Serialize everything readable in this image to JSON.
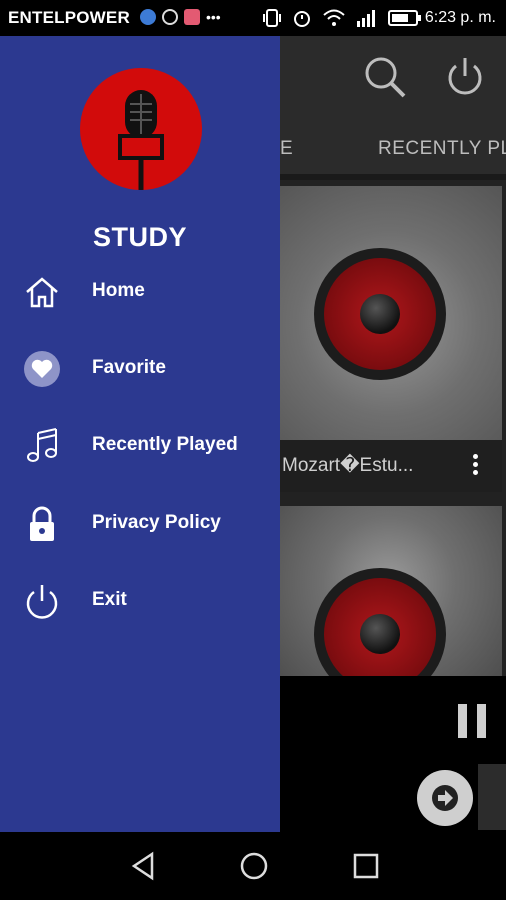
{
  "status_bar": {
    "carrier": "ENTELPOWER",
    "time": "6:23 p. m."
  },
  "drawer": {
    "title": "STUDY",
    "items": [
      {
        "label": "Home",
        "icon": "home-icon"
      },
      {
        "label": "Favorite",
        "icon": "heart-icon"
      },
      {
        "label": "Recently Played",
        "icon": "music-note-icon"
      },
      {
        "label": "Privacy Policy",
        "icon": "lock-icon"
      },
      {
        "label": "Exit",
        "icon": "power-icon"
      }
    ]
  },
  "background_app": {
    "tabs": [
      "E",
      "RECENTLY PL"
    ],
    "cards": [
      {
        "caption": "Mozart�Estu..."
      },
      {
        "caption": ""
      }
    ]
  },
  "colors": {
    "drawer_bg": "#2c3990",
    "logo_red": "#d20b0b",
    "app_bg": "#2b2b2b"
  }
}
